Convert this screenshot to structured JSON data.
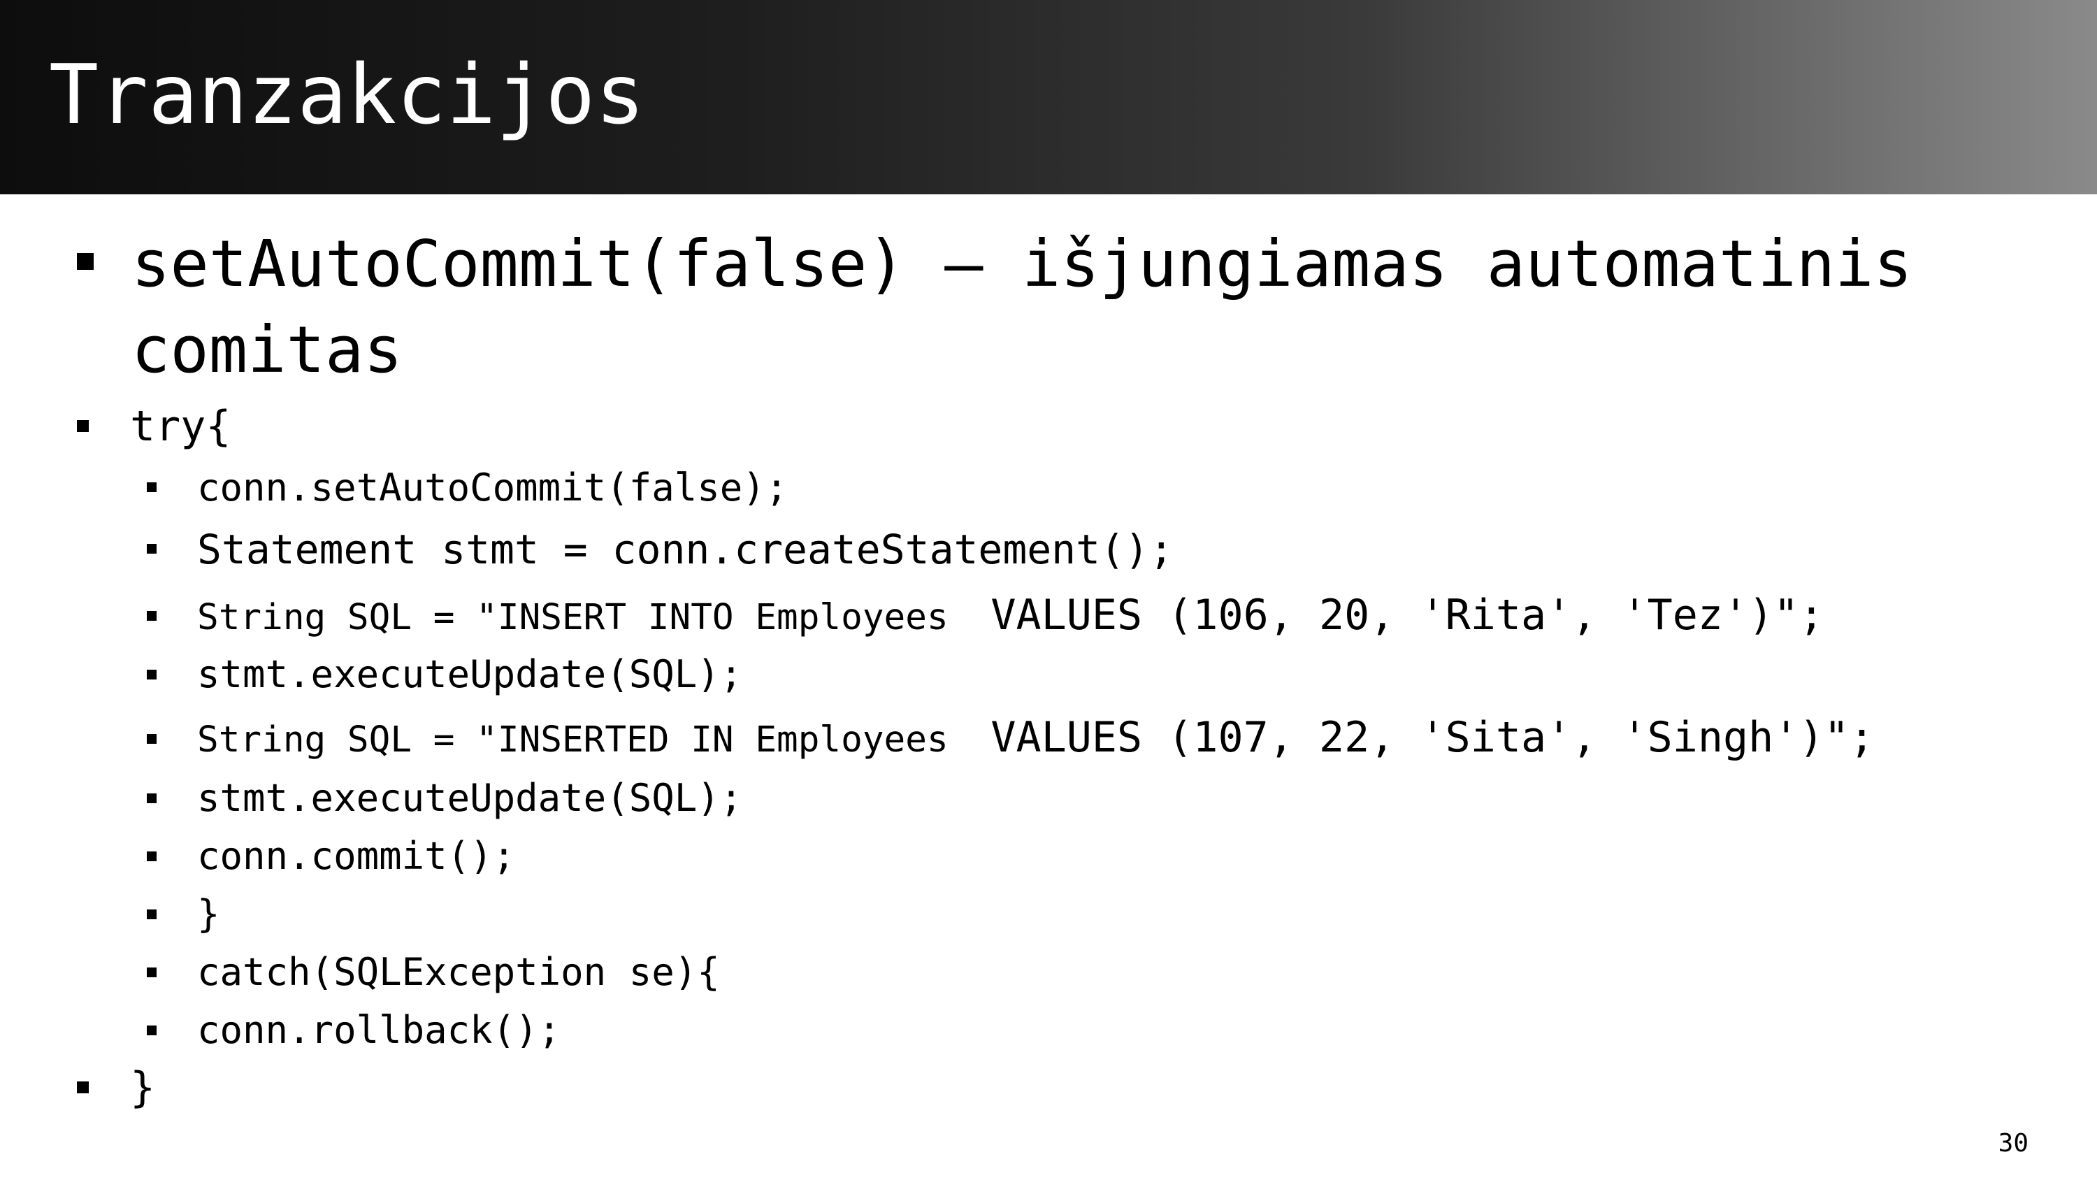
{
  "slide": {
    "title": "Tranzakcijos",
    "page_number": "30"
  },
  "bullets": {
    "item1_line1": "setAutoCommit(false) – išjungiamas automatinis",
    "item1_line2": "comitas",
    "item2": "try{",
    "sub": [
      "conn.setAutoCommit(false);",
      "Statement stmt = conn.createStatement();",
      "String SQL = \"INSERT INTO Employees ",
      "VALUES (106, 20, 'Rita', 'Tez')\";",
      "stmt.executeUpdate(SQL);",
      "String SQL = \"INSERTED IN Employees ",
      "VALUES (107, 22, 'Sita', 'Singh')\";",
      "stmt.executeUpdate(SQL);",
      "conn.commit();",
      "}",
      "catch(SQLException se){",
      "conn.rollback();"
    ],
    "item_last": "}"
  },
  "colors": {
    "title_bar_dark": "#0d0d0d",
    "title_bar_light": "#8a8a8a",
    "title_text": "#ffffff",
    "body_text": "#000000"
  }
}
